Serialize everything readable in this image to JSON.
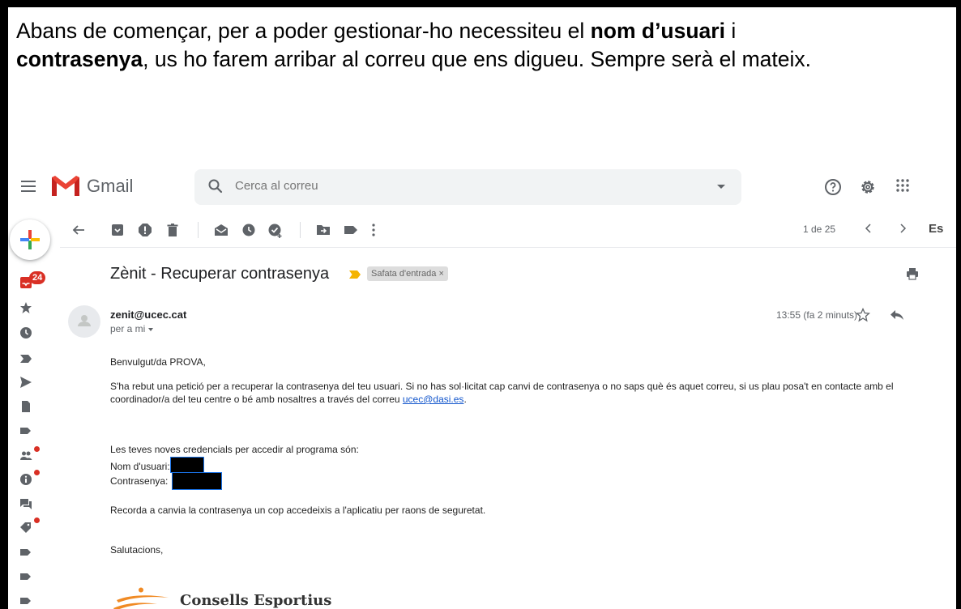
{
  "intro": {
    "part1": "Abans de començar, per a poder gestionar-ho necessiteu el ",
    "bold1": "nom d’usuari",
    "part2": " i",
    "bold2": "contrasenya",
    "part3": ", us ho farem arribar al correu que ens digueu. Sempre serà el mateix."
  },
  "gmail": {
    "app_name": "Gmail",
    "search_placeholder": "Cerca al correu",
    "pager": "1 de 25",
    "lang_cut": "Es",
    "inbox_badge": "24"
  },
  "message": {
    "subject": "Zènit - Recuperar contrasenya",
    "label": "Safata d'entrada",
    "label_close": "×",
    "sender": "zenit@ucec.cat",
    "to": "per a mi",
    "time": "13:55 (fa 2 minuts)",
    "greeting": "Benvulgut/da PROVA,",
    "para1_a": "S'ha rebut una petició per a recuperar la contrasenya del teu usuari. Si no has sol·licitat cap canvi de contrasenya o no saps què és aquet correu, si us plau posa't en contacte amb el coordinador/a del teu centre o bé amb nosaltres a través del correu ",
    "para1_link": "ucec@dasi.es",
    "para1_end": ".",
    "credentials_intro": "Les teves noves credencials per accedir al programa són:",
    "user_label": "Nom d'usuari:",
    "pass_label": "Contrasenya:",
    "reminder": "Recorda a canvia la contrasenya un cop accedeixis a l'aplicatiu per raons de seguretat.",
    "closing": "Salutacions,",
    "logo_text": "Consells Esportius"
  },
  "colors": {
    "gmail_red": "#ea4335",
    "badge_red": "#d93025",
    "importance_yellow": "#f4b400",
    "link_blue": "#1155cc",
    "logo_orange": "#f08a24"
  }
}
